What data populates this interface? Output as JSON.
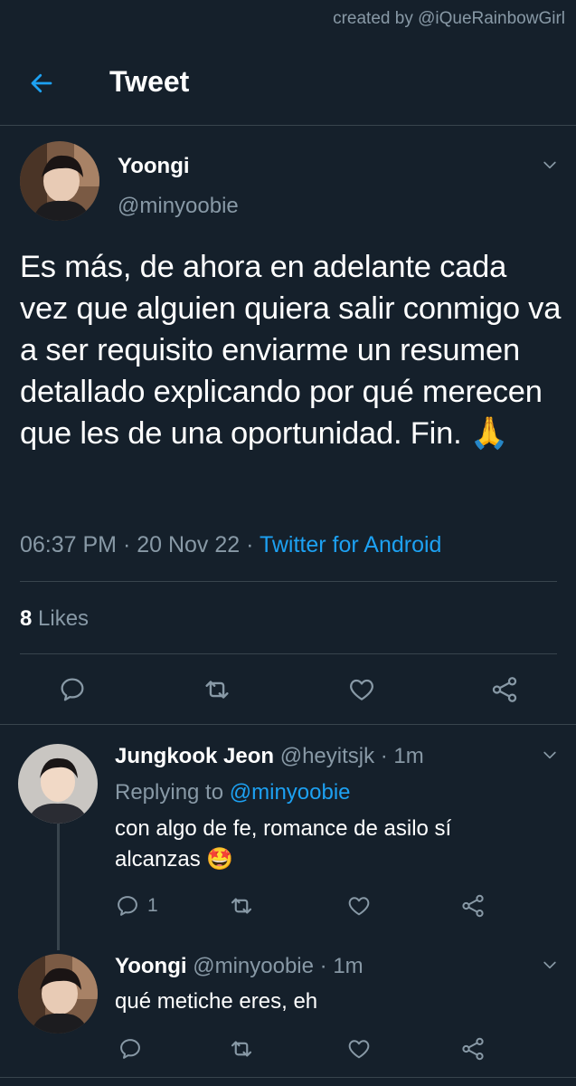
{
  "credit": "created by @iQueRainbowGirl",
  "header": {
    "title": "Tweet"
  },
  "tweet": {
    "name": "Yoongi",
    "handle": "@minyoobie",
    "text": "Es más, de ahora en adelante cada vez que alguien quiera salir conmigo va a ser requisito enviarme un resumen detallado explicando por qué merecen que les de una oportunidad. Fin. 🙏",
    "time": "06:37 PM · 20 Nov 22 · ",
    "source": "Twitter for Android",
    "likes_count": "8",
    "likes_label": "Likes"
  },
  "replies": [
    {
      "name": "Jungkook Jeon",
      "handle": "@heyitsjk",
      "time": "· 1m",
      "replying_prefix": "Replying to ",
      "replying_to": "@minyoobie",
      "text": "con algo de fe, romance de asilo sí alcanzas 🤩",
      "reply_count": "1"
    },
    {
      "name": "Yoongi",
      "handle": "@minyoobie",
      "time": "· 1m",
      "text": "qué metiche eres, eh"
    }
  ],
  "colors": {
    "background": "#15202b",
    "accent": "#1da1f2",
    "muted": "#8899a6",
    "divider": "#38444d"
  },
  "icons": [
    "back-arrow-icon",
    "chevron-down-icon",
    "reply-icon",
    "retweet-icon",
    "like-icon",
    "share-icon"
  ]
}
